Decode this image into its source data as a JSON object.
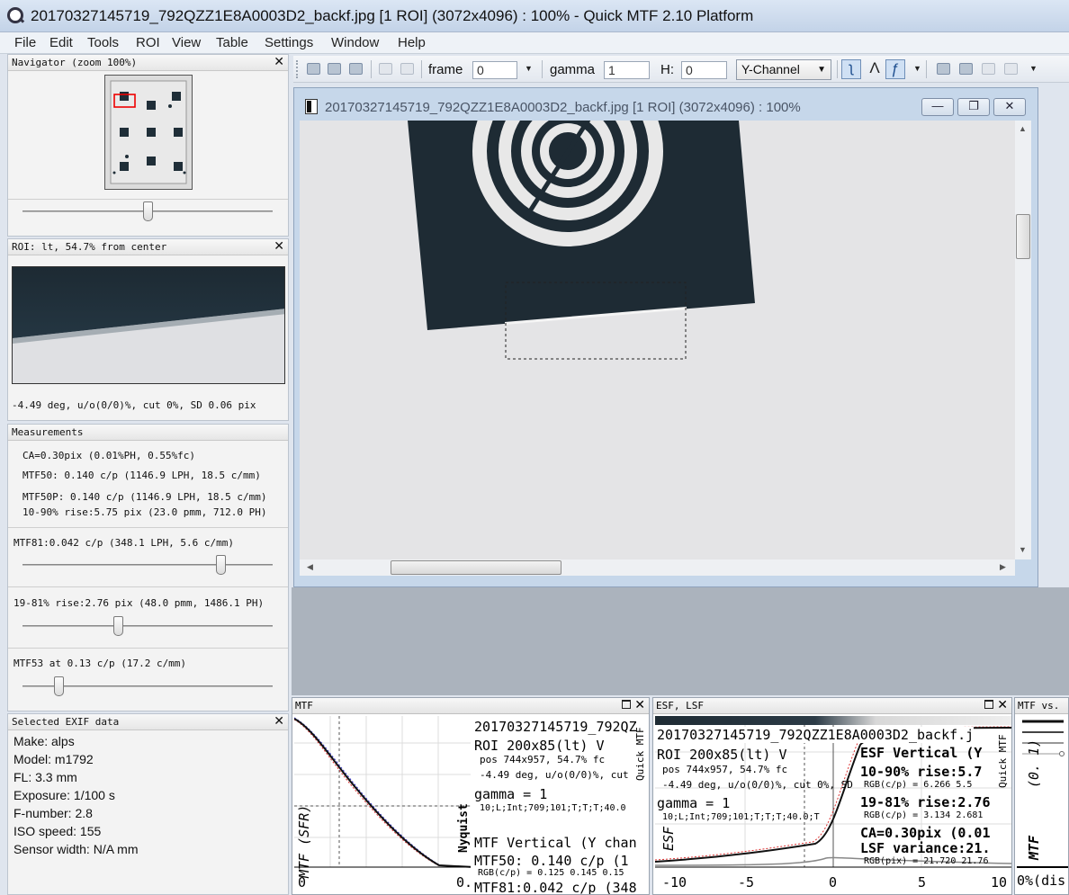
{
  "window": {
    "title": "20170327145719_792QZZ1E8A0003D2_backf.jpg [1 ROI] (3072x4096) : 100% - Quick MTF 2.10 Platform"
  },
  "menu": [
    "File",
    "Edit",
    "Tools",
    "ROI",
    "View",
    "Table",
    "Settings",
    "Window",
    "Help"
  ],
  "navigator": {
    "title": "Navigator (zoom 100%)",
    "zoom_slider": 0.5
  },
  "roi_panel": {
    "title": "ROI: lt, 54.7% from center",
    "info": "-4.49 deg, u/o(0/0)%, cut 0%, SD 0.06 pix"
  },
  "measurements": {
    "title": "Measurements",
    "ca": "CA=0.30pix (0.01%PH, 0.55%fc)",
    "mtf50": "MTF50: 0.140 c/p (1146.9 LPH, 18.5 c/mm)",
    "mtf50p": "MTF50P: 0.140 c/p (1146.9 LPH, 18.5 c/mm)",
    "rise1090": "10-90% rise:5.75 pix (23.0 pmm, 712.0 PH)",
    "mtf81": "MTF81:0.042 c/p (348.1 LPH, 5.6 c/mm)",
    "mtf81_slider": 0.8,
    "rise1981": "19-81% rise:2.76 pix (48.0 pmm, 1486.1 PH)",
    "rise1981_slider": 0.4,
    "mtf53": "MTF53 at 0.13 c/p (17.2 c/mm)",
    "mtf53_slider": 0.15
  },
  "exif": {
    "title": "Selected EXIF data",
    "lines": [
      "Make: alps",
      "Model: m1792",
      "FL: 3.3 mm",
      "Exposure: 1/100 s",
      "F-number: 2.8",
      "ISO speed: 155",
      "Sensor width: N/A mm"
    ]
  },
  "toolbar": {
    "frame_label": "frame",
    "frame_value": "0",
    "gamma_label": "gamma",
    "gamma_value": "1",
    "h_label": "H:",
    "h_value": "0",
    "channel": "Y-Channel"
  },
  "image_window": {
    "title": "20170327145719_792QZZ1E8A0003D2_backf.jpg [1 ROI] (3072x4096) : 100%",
    "min_btn": "—",
    "restore_btn": "❐",
    "close_btn": "✕"
  },
  "mtf_panel": {
    "title": "MTF",
    "file": "20170327145719_792QZ",
    "roi": "ROI 200x85(lt) V",
    "pos": "pos 744x957, 54.7% fc",
    "angle": "-4.49 deg, u/o(0/0)%, cut",
    "gamma": "gamma = 1",
    "params": "10;L;Int;709;101;T;T;T;40.0",
    "mtf_vertical": "MTF Vertical (Y chan",
    "mtf50": "MTF50: 0.140 c/p (1",
    "rgb": "RGB(c/p) = 0.125 0.145 0.15",
    "mtf81": "MTF81:0.042 c/p (348",
    "side_text": "Quick MTF",
    "nyquist": "Nyquist",
    "ylabel": "MTF (SFR)",
    "x0": "0",
    "x1": "0."
  },
  "esf_panel": {
    "title": "ESF, LSF",
    "file": "20170327145719_792QZZ1E8A0003D2_backf.j",
    "roi": "ROI 200x85(lt) V",
    "pos": "pos 744x957, 54.7% fc",
    "angle": "-4.49 deg, u/o(0/0)%, cut 0%, SD",
    "gamma": "gamma = 1",
    "params": "10;L;Int;709;101;T;T;T;40.0;T",
    "esf_vertical": "ESF Vertical (Y",
    "rise1090": "10-90% rise:5.7",
    "rgb1": "RGB(c/p) = 6.266 5.5",
    "rise1981": "19-81% rise:2.76",
    "rgb2": "RGB(c/p) = 3.134 2.681",
    "ca": "CA=0.30pix (0.01",
    "lsf": "LSF variance:21.",
    "rgb3": "RGB(pix) = 21.720 21.76",
    "side_text": "Quick MTF",
    "ylabel": "ESF",
    "ticks": [
      "-10",
      "-5",
      "0",
      "5",
      "10"
    ]
  },
  "mtfvs_panel": {
    "title": "MTF vs.",
    "ylabel": "(0. 1)",
    "ylabel2": "MTF",
    "bottom": "0%(dis"
  }
}
